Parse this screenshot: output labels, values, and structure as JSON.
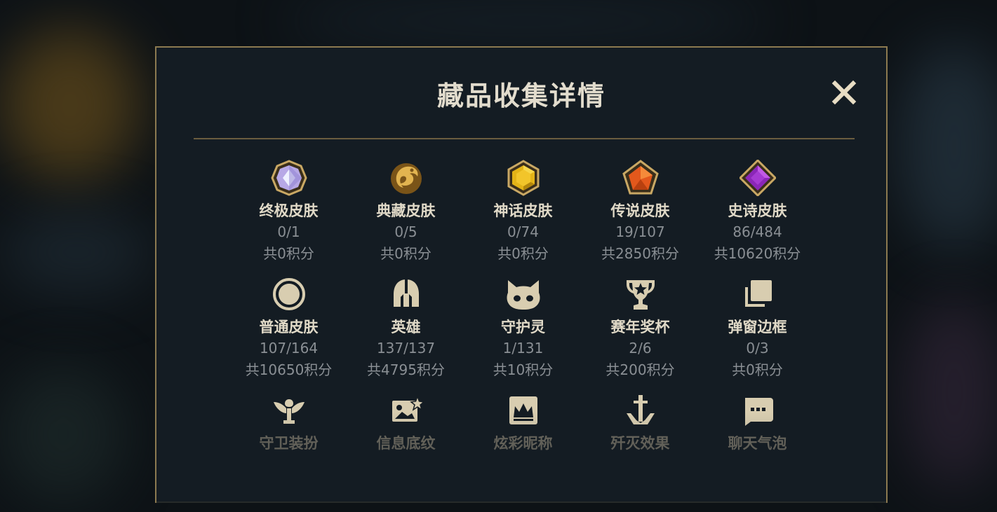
{
  "dialog": {
    "title": "藏品收集详情"
  },
  "colors": {
    "gold": "#c8b37e",
    "border": "#8c7a50",
    "panel": "#141c23"
  },
  "categories": [
    {
      "name": "终极皮肤",
      "count": "0/1",
      "points": "共0积分",
      "icon": "ultimate-gem-icon"
    },
    {
      "name": "典藏皮肤",
      "count": "0/5",
      "points": "共0积分",
      "icon": "dragon-emblem-icon"
    },
    {
      "name": "神话皮肤",
      "count": "0/74",
      "points": "共0积分",
      "icon": "mythic-gem-icon"
    },
    {
      "name": "传说皮肤",
      "count": "19/107",
      "points": "共2850积分",
      "icon": "legendary-gem-icon"
    },
    {
      "name": "史诗皮肤",
      "count": "86/484",
      "points": "共10620积分",
      "icon": "epic-gem-icon"
    },
    {
      "name": "普通皮肤",
      "count": "107/164",
      "points": "共10650积分",
      "icon": "circle-icon"
    },
    {
      "name": "英雄",
      "count": "137/137",
      "points": "共4795积分",
      "icon": "helmet-icon"
    },
    {
      "name": "守护灵",
      "count": "1/131",
      "points": "共10积分",
      "icon": "companion-icon"
    },
    {
      "name": "赛年奖杯",
      "count": "2/6",
      "points": "共200积分",
      "icon": "trophy-icon"
    },
    {
      "name": "弹窗边框",
      "count": "0/3",
      "points": "共0积分",
      "icon": "frames-icon"
    },
    {
      "name": "守卫装扮",
      "icon": "ward-icon"
    },
    {
      "name": "信息底纹",
      "icon": "banner-icon"
    },
    {
      "name": "炫彩昵称",
      "icon": "crown-card-icon"
    },
    {
      "name": "歼灭效果",
      "icon": "sword-icon"
    },
    {
      "name": "聊天气泡",
      "icon": "chat-bubble-icon"
    }
  ]
}
